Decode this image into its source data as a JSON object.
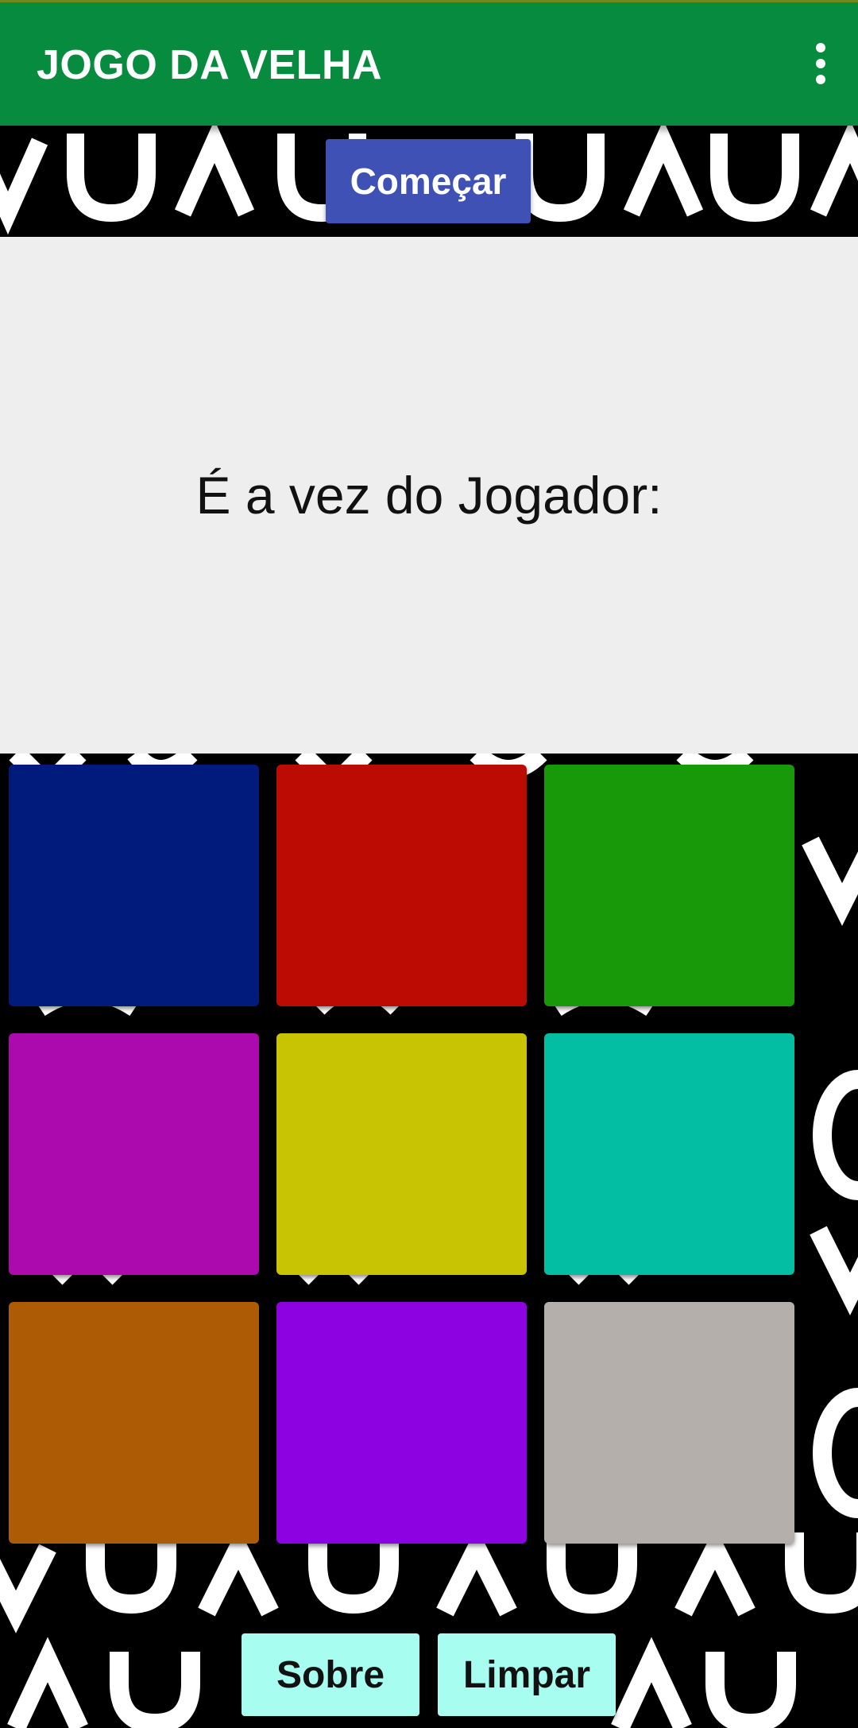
{
  "app_bar": {
    "title": "JOGO DA VELHA",
    "menu_icon": "more-vertical-icon",
    "color": "#078b3e"
  },
  "start_button": {
    "label": "Começar",
    "color": "#3f51b5"
  },
  "status": {
    "text": "É a vez do Jogador:"
  },
  "board": {
    "cells": [
      {
        "color": "#011b7c"
      },
      {
        "color": "#bb0b02"
      },
      {
        "color": "#18990a"
      },
      {
        "color": "#ac09ae"
      },
      {
        "color": "#c8c404"
      },
      {
        "color": "#03bea2"
      },
      {
        "color": "#ad5b04"
      },
      {
        "color": "#8c02e1"
      },
      {
        "color": "#b4afab"
      }
    ]
  },
  "buttons": {
    "about_label": "Sobre",
    "clear_label": "Limpar",
    "color": "#a7fdef"
  }
}
